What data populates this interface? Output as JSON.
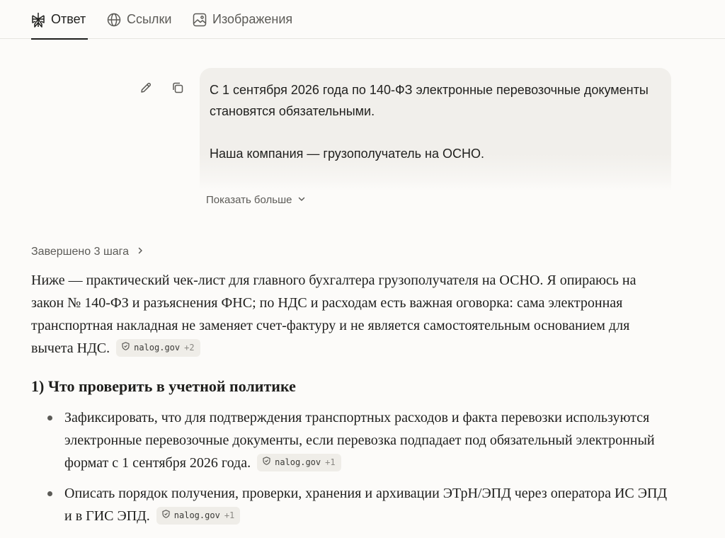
{
  "tabs": [
    {
      "label": "Ответ",
      "icon": "perplexity-logo-icon",
      "active": true
    },
    {
      "label": "Ссылки",
      "icon": "globe-icon",
      "active": false
    },
    {
      "label": "Изображения",
      "icon": "image-icon",
      "active": false
    }
  ],
  "query": {
    "line1": "С 1 сентября 2026 года по 140-ФЗ электронные перевозочные документы становятся обязательными.",
    "line2": "Наша компания — грузополучатель на ОСНО.",
    "show_more": "Показать больше"
  },
  "steps": {
    "label": "Завершено 3 шага"
  },
  "answer": {
    "intro": "Ниже — практический чек-лист для главного бухгалтера грузополучателя на ОСНО. Я опираюсь на закон № 140-ФЗ и разъяснения ФНС; по НДС и расходам есть важная оговорка: сама электронная транспортная накладная не заменяет счет-фактуру и не является самостоятельным основанием для вычета НДС.",
    "intro_cite": {
      "source": "nalog.gov",
      "extra": "+2"
    },
    "section1_title": "1) Что проверить в учетной политике",
    "bullets": [
      {
        "text": "Зафиксировать, что для подтверждения транспортных расходов и факта перевозки используются электронные перевозочные документы, если перевозка подпадает под обязательный электронный формат с 1 сентября 2026 года.",
        "cite_source": "nalog.gov",
        "cite_extra": "+1"
      },
      {
        "text": "Описать порядок получения, проверки, хранения и архивации ЭТрН/ЭПД через оператора ИС ЭПД и в ГИС ЭПД.",
        "cite_source": "nalog.gov",
        "cite_extra": "+1"
      }
    ]
  },
  "colors": {
    "background": "#fcfbf9",
    "bubble": "#f1efeb",
    "text": "#1f1f1d",
    "muted": "#5c5b57",
    "chip": "#efede8"
  }
}
